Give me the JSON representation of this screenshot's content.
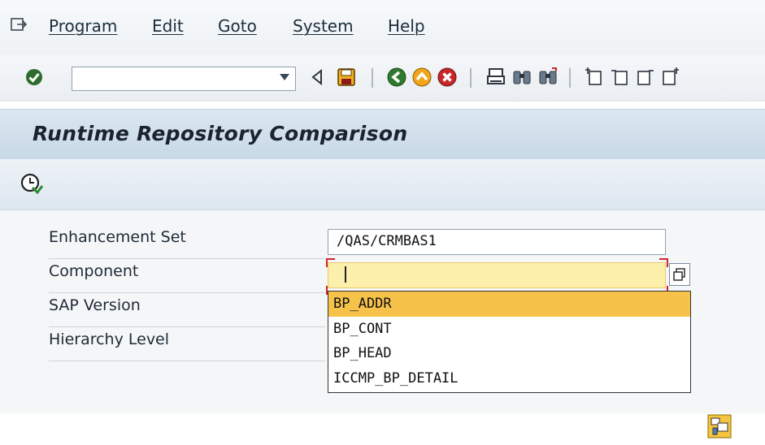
{
  "menubar": {
    "items": [
      {
        "label": "Program"
      },
      {
        "label": "Edit"
      },
      {
        "label": "Goto"
      },
      {
        "label": "System"
      },
      {
        "label": "Help"
      }
    ]
  },
  "toolbar": {
    "command_field_value": "",
    "icons": [
      "enter-icon",
      "back-triangle-icon",
      "save-icon",
      "back-icon",
      "exit-icon",
      "cancel-icon",
      "print-icon",
      "find-icon",
      "find-next-icon",
      "first-page-icon",
      "previous-page-icon",
      "next-page-icon",
      "last-page-icon"
    ]
  },
  "screen": {
    "title": "Runtime Repository Comparison",
    "execute_icon": "execute-icon"
  },
  "form": {
    "enhancement_set": {
      "label": "Enhancement Set",
      "value": "/QAS/CRMBAS1"
    },
    "component": {
      "label": "Component",
      "value": ""
    },
    "sap_version": {
      "label": "SAP Version"
    },
    "hierarchy_level": {
      "label": "Hierarchy Level"
    }
  },
  "dropdown": {
    "options": [
      "BP_ADDR",
      "BP_CONT",
      "BP_HEAD",
      "ICCMP_BP_DETAIL"
    ],
    "selected": "BP_ADDR"
  },
  "colors": {
    "title_bar": "#c8d8e6",
    "active_field": "#fdf0ad",
    "selected_option": "#f7c24a",
    "required_marker": "#d0262b"
  }
}
